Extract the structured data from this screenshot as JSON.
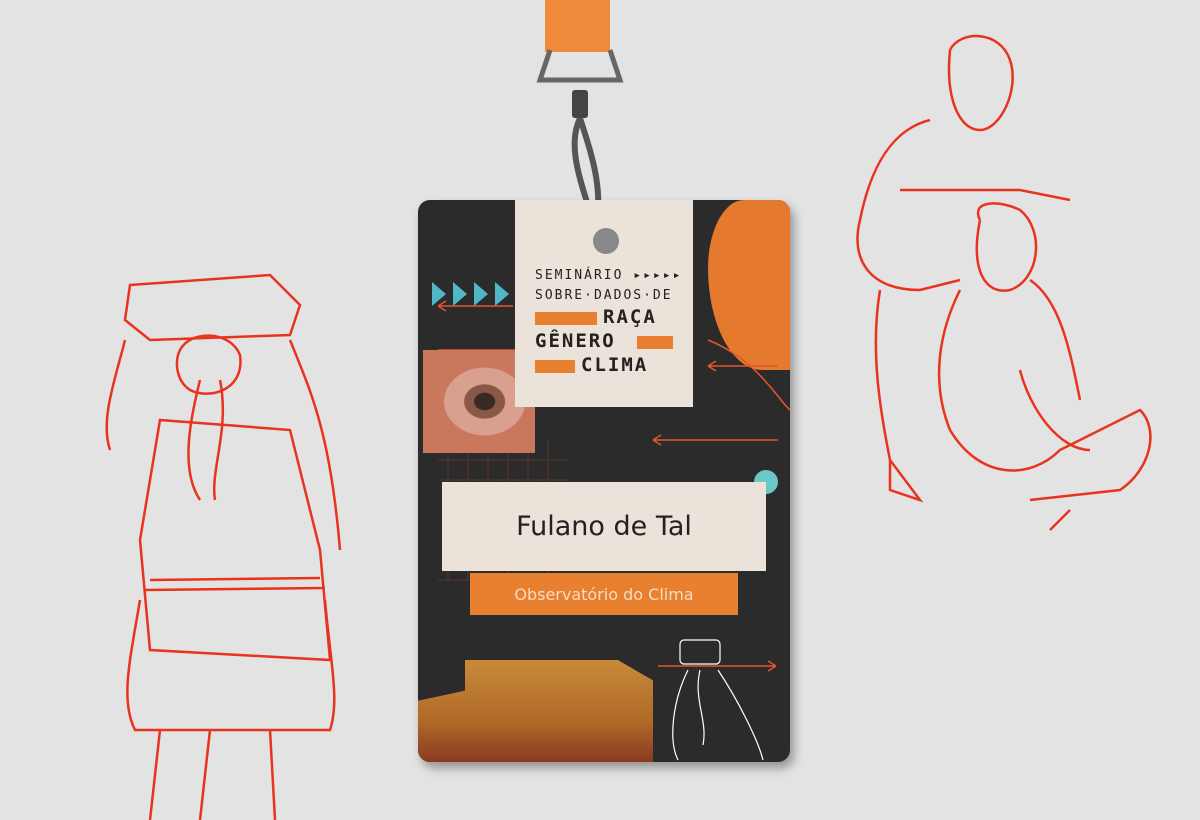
{
  "badge": {
    "logo": {
      "line1": "SEMINÁRIO ▸▸▸▸▸",
      "line2": "SOBRE·DADOS·DE",
      "line3": "RAÇA",
      "line4": "GÊNERO",
      "line5": "CLIMA"
    },
    "name": "Fulano de Tal",
    "organization": "Observatório do Clima"
  },
  "colors": {
    "accent": "#e9802f",
    "badge_bg": "#2b2b2b",
    "teal": "#6cc7c6",
    "sketch": "#e8341f"
  }
}
